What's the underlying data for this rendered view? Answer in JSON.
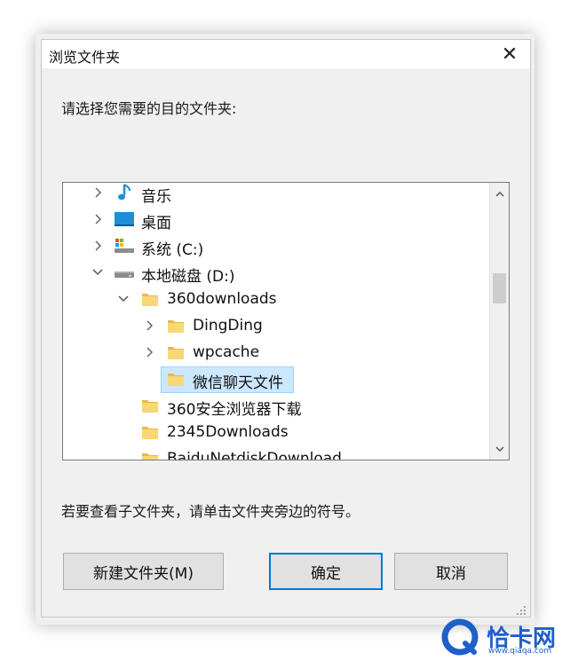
{
  "dialog": {
    "title": "浏览文件夹",
    "close_label": "✕",
    "prompt": "请选择您需要的目的文件夹:",
    "hint": "若要查看子文件夹，请单击文件夹旁边的符号。"
  },
  "tree": {
    "items": [
      {
        "label": "音乐",
        "icon": "music-note-icon",
        "expander": "collapsed",
        "level": 0
      },
      {
        "label": "桌面",
        "icon": "desktop-icon",
        "expander": "collapsed",
        "level": 0
      },
      {
        "label": "系统 (C:)",
        "icon": "system-drive-icon",
        "expander": "collapsed",
        "level": 0
      },
      {
        "label": "本地磁盘 (D:)",
        "icon": "drive-icon",
        "expander": "expanded",
        "level": 0
      },
      {
        "label": "360downloads",
        "icon": "folder-icon",
        "expander": "expanded",
        "level": 1
      },
      {
        "label": "DingDing",
        "icon": "folder-icon",
        "expander": "collapsed",
        "level": 2
      },
      {
        "label": "wpcache",
        "icon": "folder-icon",
        "expander": "collapsed",
        "level": 2
      },
      {
        "label": "微信聊天文件",
        "icon": "folder-icon",
        "expander": "none",
        "level": 2,
        "selected": true
      },
      {
        "label": "360安全浏览器下载",
        "icon": "folder-icon",
        "expander": "none",
        "level": 1
      },
      {
        "label": "2345Downloads",
        "icon": "folder-icon",
        "expander": "none",
        "level": 1
      },
      {
        "label": "BaiduNetdiskDownload",
        "icon": "folder-icon",
        "expander": "none",
        "level": 1
      }
    ]
  },
  "buttons": {
    "new_folder": "新建文件夹(M)",
    "ok": "确定",
    "cancel": "取消"
  },
  "watermark": {
    "text": "恰卡网",
    "sub": "www.qiaqa.com"
  },
  "colors": {
    "selection_bg": "#cce8ff",
    "selection_border": "#99d1ff",
    "primary_border": "#0078d7",
    "folder_yellow": "#f8d775"
  }
}
